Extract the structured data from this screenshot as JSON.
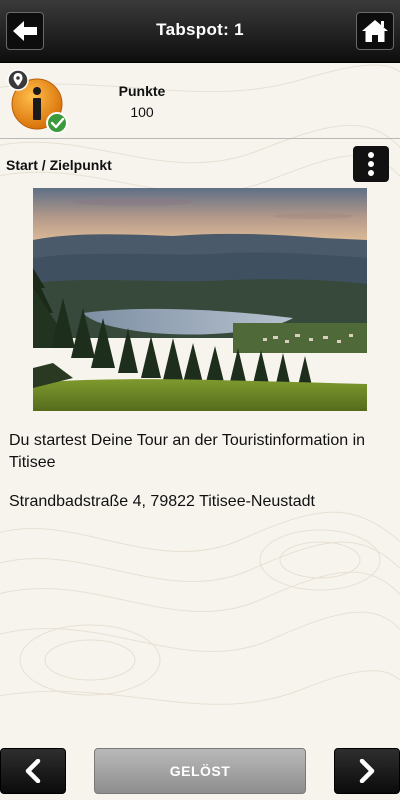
{
  "header": {
    "title_label": "Tabspot:",
    "title_number": "1",
    "back_icon": "arrow-left-icon",
    "home_icon": "home-icon"
  },
  "score": {
    "badge_icon": "info-badge-icon",
    "label": "Punkte",
    "value": "100"
  },
  "section": {
    "title": "Start / Zielpunkt",
    "menu_icon": "vertical-dots-icon"
  },
  "content": {
    "description": "Du startest Deine Tour an der Touristinformation in Titisee",
    "address": "Strandbadstraße 4, 79822 Titisee-Neustadt"
  },
  "footer": {
    "prev_icon": "chevron-left-icon",
    "solved_label": "GELÖST",
    "next_icon": "chevron-right-icon"
  },
  "colors": {
    "background": "#f7f4ee",
    "header": "#1a1a1a",
    "badge_orange": "#e88a10",
    "check_green": "#3c9a3c",
    "solved_button": "#a5a5a5"
  }
}
